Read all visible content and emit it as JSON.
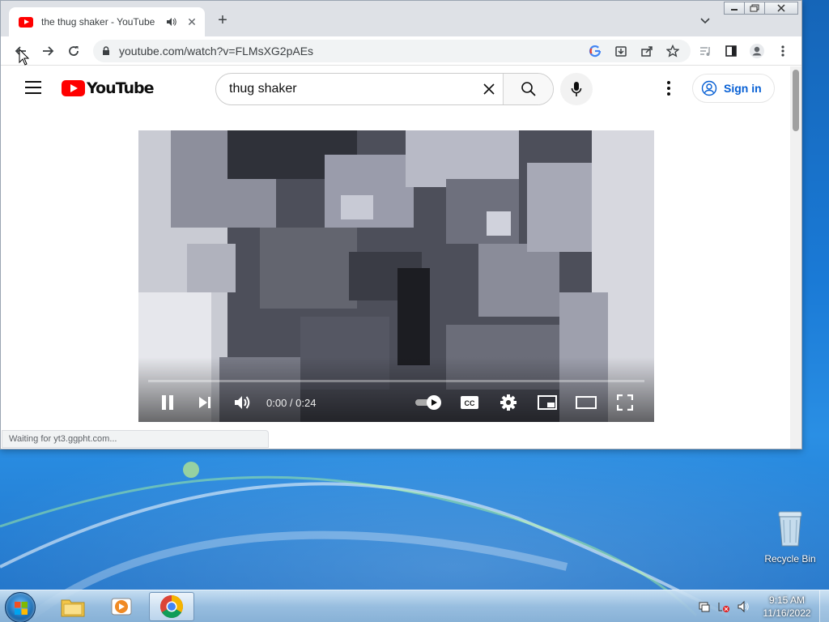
{
  "browser": {
    "tab_title": "the thug shaker - YouTube",
    "tab_close": "✕",
    "new_tab": "+",
    "url": "youtube.com/watch?v=FLMsXG2pAEs",
    "status_text": "Waiting for yt3.ggpht.com..."
  },
  "youtube": {
    "logo_text": "YouTube",
    "search_value": "thug shaker",
    "sign_in_label": "Sign in"
  },
  "player": {
    "time_display": "0:00 / 0:24",
    "progress_fraction": 0.0,
    "state": "playing",
    "autoplay": "on",
    "controls": [
      "pause",
      "next",
      "volume",
      "autoplay",
      "captions",
      "settings",
      "miniplayer",
      "theater",
      "fullscreen"
    ]
  },
  "desktop": {
    "recycle_bin_label": "Recycle Bin"
  },
  "taskbar": {
    "clock_time": "9:15 AM",
    "clock_date": "11/16/2022",
    "pinned": [
      "explorer-icon",
      "media-player-icon",
      "chrome-icon"
    ],
    "active": "chrome-icon"
  },
  "colors": {
    "youtube_red": "#ff0000",
    "signin_blue": "#065fd4",
    "chrome_tabstrip": "#dee1e6"
  }
}
